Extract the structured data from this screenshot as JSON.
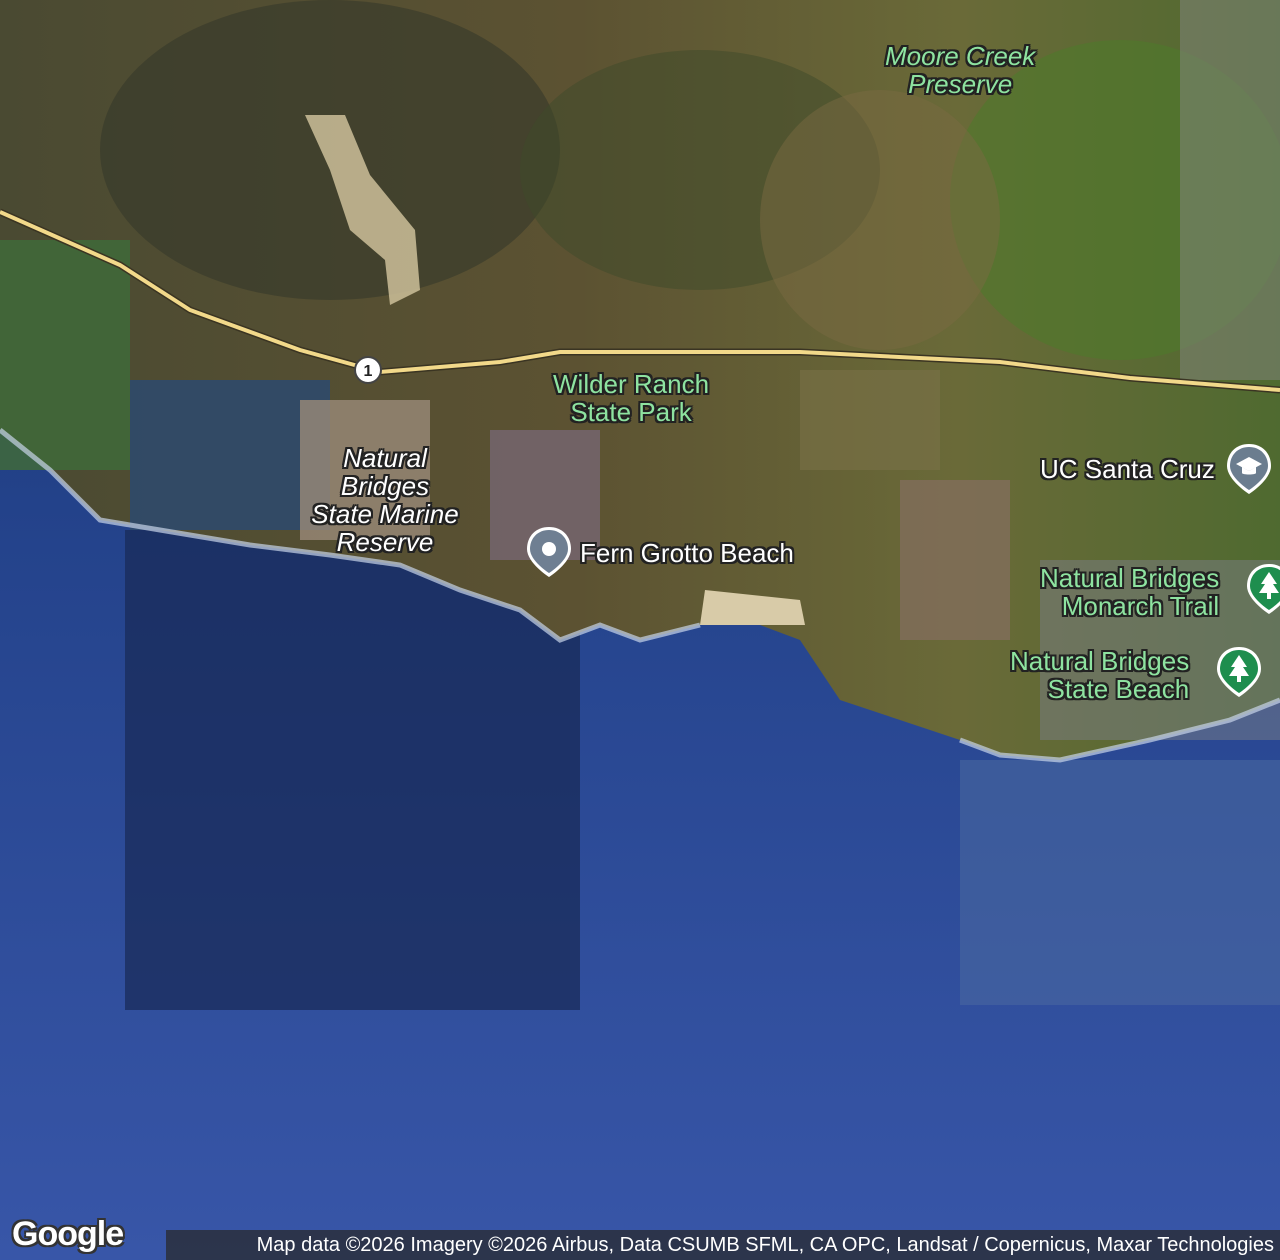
{
  "map": {
    "labels": {
      "moore_creek": "Moore Creek\nPreserve",
      "wilder_ranch": "Wilder Ranch\nState Park",
      "natural_bridges_reserve": "Natural\nBridges\nState Marine\nReserve",
      "fern_grotto": "Fern Grotto Beach",
      "uc_santa_cruz": "UC Santa Cruz",
      "monarch_trail": "Natural Bridges\nMonarch Trail",
      "natural_bridges_beach": "Natural Bridges\nState Beach"
    },
    "route_shield": "1",
    "logo": "Google",
    "attribution": "Map data ©2026 Imagery ©2026 Airbus, Data CSUMB SFML, CA OPC, Landsat / Copernicus, Maxar Technologies"
  },
  "colors": {
    "park_label": "#8ee3a0",
    "park_pin": "#1e8e4e",
    "school_pin": "#6b7d8f",
    "highway": "#f2d98a"
  },
  "icons": {
    "tree": "tree-icon",
    "school": "graduation-cap-icon",
    "place": "place-pin-icon"
  }
}
